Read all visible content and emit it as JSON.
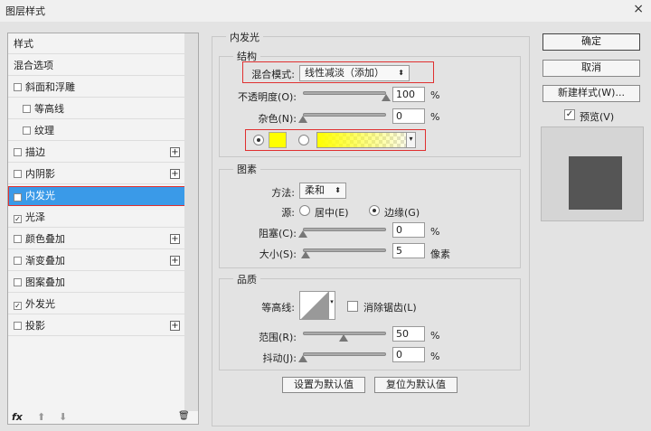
{
  "window": {
    "title": "图层样式",
    "close": "×"
  },
  "sidebar": {
    "items": [
      {
        "label": "样式",
        "checkbox": false,
        "checked": false,
        "plus": false
      },
      {
        "label": "混合选项",
        "checkbox": false,
        "checked": false,
        "plus": false
      },
      {
        "label": "斜面和浮雕",
        "checkbox": true,
        "checked": false,
        "plus": false
      },
      {
        "label": "等高线",
        "checkbox": true,
        "checked": false,
        "plus": false,
        "indent": true
      },
      {
        "label": "纹理",
        "checkbox": true,
        "checked": false,
        "plus": false,
        "indent": true
      },
      {
        "label": "描边",
        "checkbox": true,
        "checked": false,
        "plus": true
      },
      {
        "label": "内阴影",
        "checkbox": true,
        "checked": false,
        "plus": true
      },
      {
        "label": "内发光",
        "checkbox": true,
        "checked": true,
        "plus": false,
        "selected": true
      },
      {
        "label": "光泽",
        "checkbox": true,
        "checked": true,
        "plus": false
      },
      {
        "label": "颜色叠加",
        "checkbox": true,
        "checked": false,
        "plus": true
      },
      {
        "label": "渐变叠加",
        "checkbox": true,
        "checked": false,
        "plus": true
      },
      {
        "label": "图案叠加",
        "checkbox": true,
        "checked": false,
        "plus": false
      },
      {
        "label": "外发光",
        "checkbox": true,
        "checked": true,
        "plus": false
      },
      {
        "label": "投影",
        "checkbox": true,
        "checked": false,
        "plus": true
      }
    ],
    "toolbar": {
      "fx": "fx",
      "up": "⬆",
      "down": "⬇",
      "trash": "🗑"
    }
  },
  "panel": {
    "title": "内发光",
    "structure": {
      "title": "结构",
      "blend_label": "混合模式:",
      "blend_value": "线性减淡（添加）",
      "opacity_label": "不透明度(O):",
      "opacity": "100",
      "opacity_unit": "%",
      "noise_label": "杂色(N):",
      "noise": "0",
      "noise_unit": "%",
      "color": "#ffff00"
    },
    "elements": {
      "title": "图素",
      "method_label": "方法:",
      "method_value": "柔和",
      "source_label": "源:",
      "center": "居中(E)",
      "edge": "边缘(G)",
      "choke_label": "阻塞(C):",
      "choke": "0",
      "choke_unit": "%",
      "size_label": "大小(S):",
      "size": "5",
      "size_unit": "像素"
    },
    "quality": {
      "title": "品质",
      "contour_label": "等高线:",
      "antialias": "消除锯齿(L)",
      "range_label": "范围(R):",
      "range": "50",
      "range_unit": "%",
      "jitter_label": "抖动(J):",
      "jitter": "0",
      "jitter_unit": "%"
    },
    "default_btn": "设置为默认值",
    "reset_btn": "复位为默认值"
  },
  "actions": {
    "ok": "确定",
    "cancel": "取消",
    "new_style": "新建样式(W)...",
    "preview": "预览(V)"
  }
}
